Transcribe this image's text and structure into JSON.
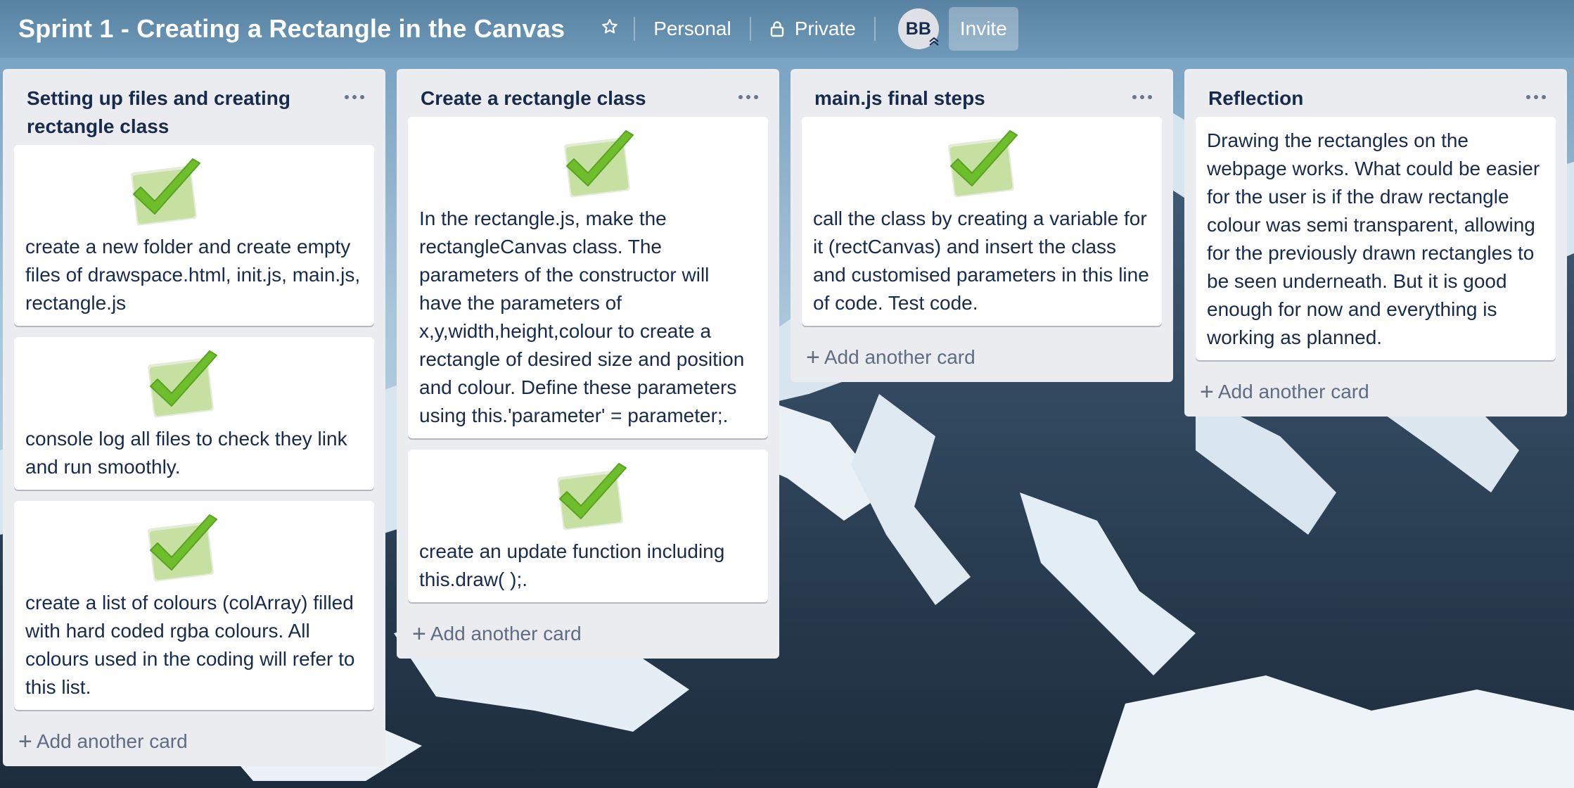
{
  "header": {
    "board_title": "Sprint 1 - Creating a Rectangle in the Canvas",
    "star_icon": "star-icon",
    "team_label": "Personal",
    "visibility_label": "Private",
    "visibility_icon": "lock-icon",
    "avatar_initials": "BB",
    "invite_label": "Invite"
  },
  "colors": {
    "list_bg": "#ebecf0",
    "card_bg": "#ffffff",
    "text": "#172b4d",
    "muted": "#5e6c84",
    "check_green": "#6ebe2c"
  },
  "lists": [
    {
      "title": "Setting up files and creating rectangle class",
      "cards": [
        {
          "cover": "check-icon",
          "text": "create a new folder and create empty files of drawspace.html, init.js, main.js, rectangle.js"
        },
        {
          "cover": "check-icon",
          "text": "console log all files to check they link and run smoothly."
        },
        {
          "cover": "check-icon",
          "text": "create a list of colours (colArray) filled with hard coded rgba colours. All colours used in the coding will refer to this list."
        }
      ],
      "add_card_label": "Add another card"
    },
    {
      "title": "Create a rectangle class",
      "cards": [
        {
          "cover": "check-icon",
          "text": "In the rectangle.js, make the rectangleCanvas class. The parameters of the constructor will have the parameters of x,y,width,height,colour to create a rectangle of desired size and position and colour. Define these parameters using this.'parameter' = parameter;."
        },
        {
          "cover": "check-icon",
          "text": "create an update function including this.draw( );."
        }
      ],
      "add_card_label": "Add another card"
    },
    {
      "title": "main.js final steps",
      "cards": [
        {
          "cover": "check-icon",
          "text": "call the class by creating a variable for it (rectCanvas) and insert the class and customised parameters in this line of code. Test code."
        }
      ],
      "add_card_label": "Add another card"
    },
    {
      "title": "Reflection",
      "cards": [
        {
          "text": "Drawing the rectangles on the webpage works. What could be easier for the user is if the draw rectangle colour was semi transparent, allowing for the previously drawn rectangles to be seen underneath. But it is good enough for now and everything is working as planned."
        }
      ],
      "add_card_label": "Add another card"
    }
  ]
}
